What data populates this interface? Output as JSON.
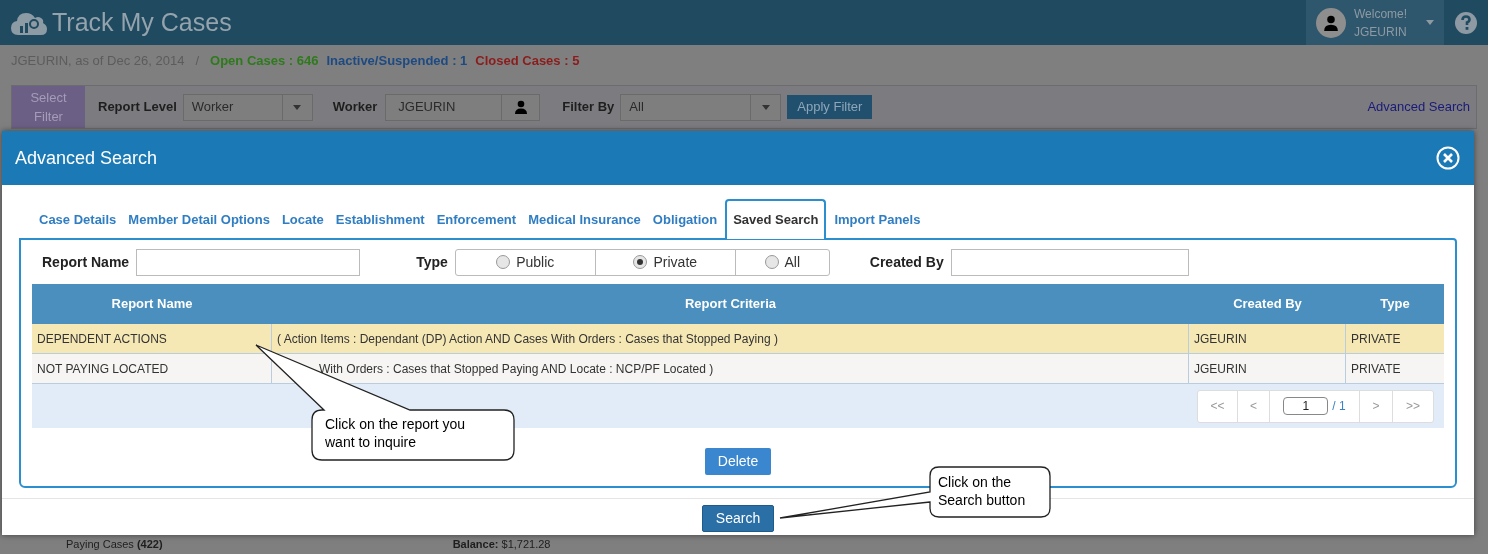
{
  "app": {
    "title": "Track My Cases",
    "user": {
      "greeting": "Welcome!",
      "name": "JGEURIN"
    }
  },
  "summary": {
    "user_date": "JGEURIN, as of Dec 26, 2014",
    "separator": "/",
    "counts": [
      {
        "label": "Open Cases : 646",
        "color": "#2e7a1c"
      },
      {
        "label": "Inactive/Suspended : 1",
        "color": "#1d4a82"
      },
      {
        "label": "Closed Cases : 5",
        "color": "#8c1c1c"
      }
    ]
  },
  "filter_bar": {
    "select_filter": "Select Filter",
    "report_level": {
      "label": "Report Level",
      "value": "Worker"
    },
    "worker": {
      "label": "Worker",
      "value": "JGEURIN"
    },
    "filter_by": {
      "label": "Filter By",
      "value": "All"
    },
    "apply": "Apply Filter",
    "advanced_link": "Advanced Search"
  },
  "dialog": {
    "title": "Advanced Search",
    "tabs": [
      {
        "label": "Case Details",
        "selected": false
      },
      {
        "label": "Member Detail Options",
        "selected": false
      },
      {
        "label": "Locate",
        "selected": false
      },
      {
        "label": "Establishment",
        "selected": false
      },
      {
        "label": "Enforcement",
        "selected": false
      },
      {
        "label": "Medical Insurance",
        "selected": false
      },
      {
        "label": "Obligation",
        "selected": false
      },
      {
        "label": "Saved Search",
        "selected": true
      },
      {
        "label": "Import Panels",
        "selected": false
      }
    ],
    "report_name": {
      "label": "Report Name"
    },
    "type": {
      "label": "Type",
      "options": [
        {
          "label": "Public",
          "selected": false
        },
        {
          "label": "Private",
          "selected": true
        },
        {
          "label": "All",
          "selected": false
        }
      ]
    },
    "created_by": {
      "label": "Created By"
    },
    "table": {
      "columns": [
        "Report Name",
        "Report Criteria",
        "Created By",
        "Type"
      ],
      "rows": [
        {
          "selected": true,
          "cells": [
            "DEPENDENT ACTIONS",
            "( Action Items : Dependant (DP) Action AND Cases With Orders : Cases that Stopped Paying )",
            "JGEURIN",
            "PRIVATE"
          ]
        },
        {
          "selected": false,
          "criteria_covered": true,
          "cells": [
            "NOT PAYING LOCATED",
            "With Orders : Cases that Stopped Paying AND Locate : NCP/PF Located )",
            "JGEURIN",
            "PRIVATE"
          ]
        }
      ]
    },
    "pager": {
      "first": "<<",
      "prev": "<",
      "page": "1",
      "total": "/ 1",
      "next": ">",
      "last": ">>"
    },
    "delete": "Delete",
    "search": "Search"
  },
  "callouts": [
    {
      "text": "Click on the report you want to inquire"
    },
    {
      "text": "Click on the Search button"
    }
  ],
  "background": {
    "left": "Paying Cases **(422)**",
    "right": "**Balance:** $1,721.28"
  }
}
